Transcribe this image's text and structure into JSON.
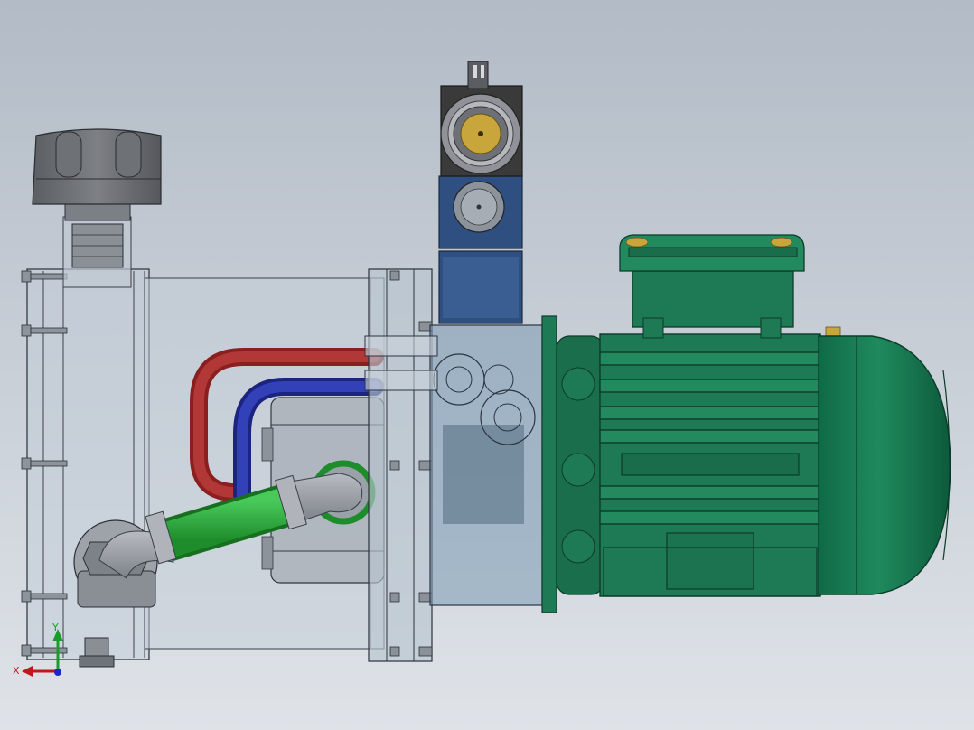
{
  "colors": {
    "background_top": "#b2bbc6",
    "background_bottom": "#dfe3e8",
    "motor_green": "#1e7a55",
    "motor_green_light": "#2e9a6e",
    "motor_green_dark": "#0f4d34",
    "valve_blue": "#2e4f80",
    "valve_blue_light": "#3e6aa8",
    "valve_dark": "#3a3a3a",
    "hose_red": "#a52a2a",
    "hose_blue": "#26309e",
    "hose_green": "#2fb03a",
    "tank_glass": "#c2cdd8",
    "fitting_grey": "#9aa0a8",
    "cap_grey": "#6c6f73",
    "brass": "#c9a63c"
  },
  "icons": {
    "triad": "xyz-triad-icon",
    "terminal_screw": "terminal-screw-icon"
  },
  "triad": {
    "x_label": "X",
    "y_label": "Y"
  }
}
